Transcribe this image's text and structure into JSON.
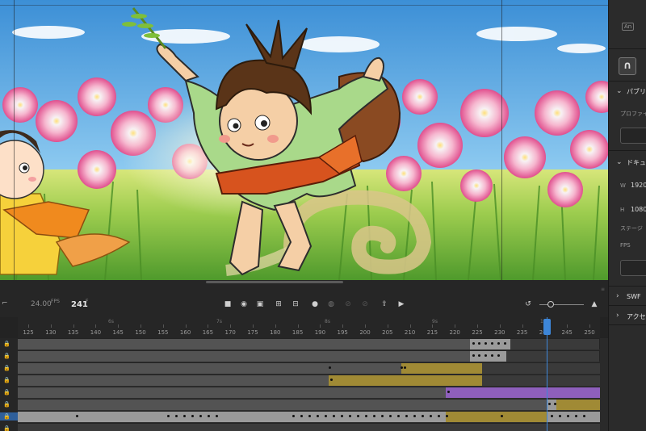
{
  "app": {
    "name": "Adobe Animate",
    "logo_text": "An"
  },
  "right_panel": {
    "section_properties": "パブリ",
    "profile_label": "プロファイ",
    "section_document": "ドキュ",
    "width_label": "W",
    "width_value": "1920",
    "height_label": "H",
    "height_value": "1080",
    "stage_label": "ステージ",
    "fps_label": "FPS",
    "section_swf": "SWF",
    "section_accessibility": "アクセ"
  },
  "timeline": {
    "fps_value": "24.00",
    "fps_unit": "FPS",
    "current_frame": "241",
    "frame_unit": "F",
    "ruler_ticks": [
      "125",
      "130",
      "135",
      "140",
      "145",
      "150",
      "155",
      "160",
      "165",
      "170",
      "175",
      "180",
      "185",
      "190",
      "195",
      "200",
      "205",
      "210",
      "215",
      "220",
      "225",
      "230",
      "235",
      "240",
      "245",
      "250"
    ],
    "ruler_seconds": [
      "6s",
      "7s",
      "8s",
      "9s",
      "10s"
    ],
    "icons": [
      "stop-icon",
      "record-icon",
      "frame-box-icon",
      "insert-keyframe-icon",
      "clear-keyframe-icon",
      "onion-skin-icon",
      "onion-skin-outline-icon",
      "edit-multiple-icon",
      "onion-range-icon",
      "loop-icon",
      "play-icon"
    ],
    "colors": {
      "tween_olive": "#a08a35",
      "tween_purple": "#8e5fbc",
      "keyframe_gray": "#9a9a9a",
      "empty_row": "#535353",
      "playhead": "#3d86d8"
    }
  },
  "stage": {
    "scene": "Cartoon boy in green kimono among pink cosmos flowers"
  }
}
